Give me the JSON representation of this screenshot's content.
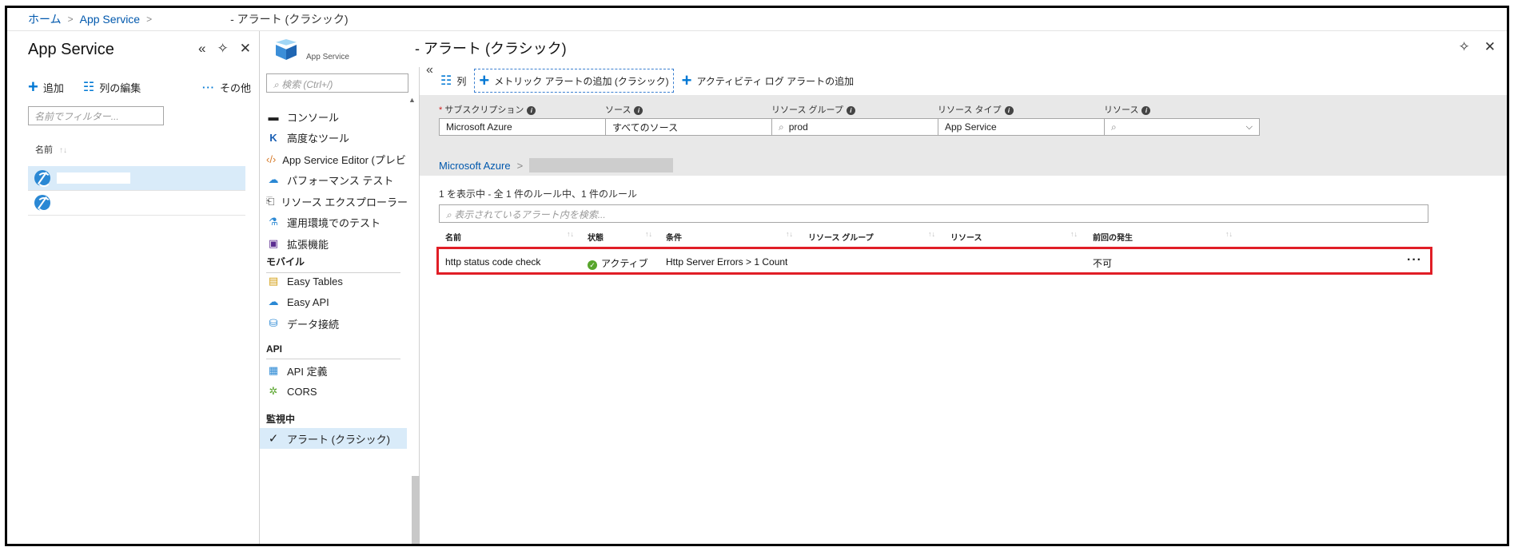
{
  "breadcrumb": {
    "home": "ホーム",
    "app_service": "App Service",
    "current": "- アラート (クラシック)"
  },
  "left_blade": {
    "title": "App Service",
    "toolbar": {
      "add": "追加",
      "edit_columns": "列の編集",
      "more": "その他"
    },
    "filter_placeholder": "名前でフィルター...",
    "column_name": "名前"
  },
  "resource_blade": {
    "subtitle": "App Service",
    "title": "- アラート (クラシック)",
    "menu": {
      "search_placeholder": "検索 (Ctrl+/)",
      "items_top": [
        "コンソール",
        "高度なツール",
        "App Service Editor (プレビ…",
        "パフォーマンス テスト",
        "リソース エクスプローラー",
        "運用環境でのテスト",
        "拡張機能"
      ],
      "section_mobile": "モバイル",
      "items_mobile": [
        "Easy Tables",
        "Easy API",
        "データ接続"
      ],
      "section_api": "API",
      "items_api": [
        "API 定義",
        "CORS"
      ],
      "section_monitor": "監視中",
      "items_monitor": [
        "アラート (クラシック)"
      ]
    }
  },
  "content": {
    "toolbar": {
      "columns": "列",
      "add_metric_alert": "メトリック アラートの追加 (クラシック)",
      "add_activity_alert": "アクティビティ ログ アラートの追加"
    },
    "filters": {
      "subscription_label": "サブスクリプション",
      "subscription_value": "Microsoft Azure",
      "source_label": "ソース",
      "source_value": "すべてのソース",
      "rg_label": "リソース グループ",
      "rg_value": "prod",
      "rtype_label": "リソース タイプ",
      "rtype_value": "App Service",
      "resource_label": "リソース",
      "resource_value": ""
    },
    "filter_breadcrumb": "Microsoft Azure",
    "summary": "1 を表示中 - 全 1 件のルール中、1 件のルール",
    "alert_search_placeholder": "表示されているアラート内を検索...",
    "table": {
      "headers": [
        "名前",
        "状態",
        "条件",
        "リソース グループ",
        "リソース",
        "前回の発生"
      ],
      "rows": [
        {
          "name": "http status code check",
          "status": "アクティブ",
          "condition": "Http Server Errors > 1 Count",
          "resource_group": "",
          "resource": "",
          "last_fired": "不可"
        }
      ]
    }
  },
  "colors": {
    "accent": "#0078d4",
    "link": "#0058ad",
    "selected": "#d9ebf9",
    "highlight_border": "#e01e26",
    "active_status": "#58a52c"
  }
}
